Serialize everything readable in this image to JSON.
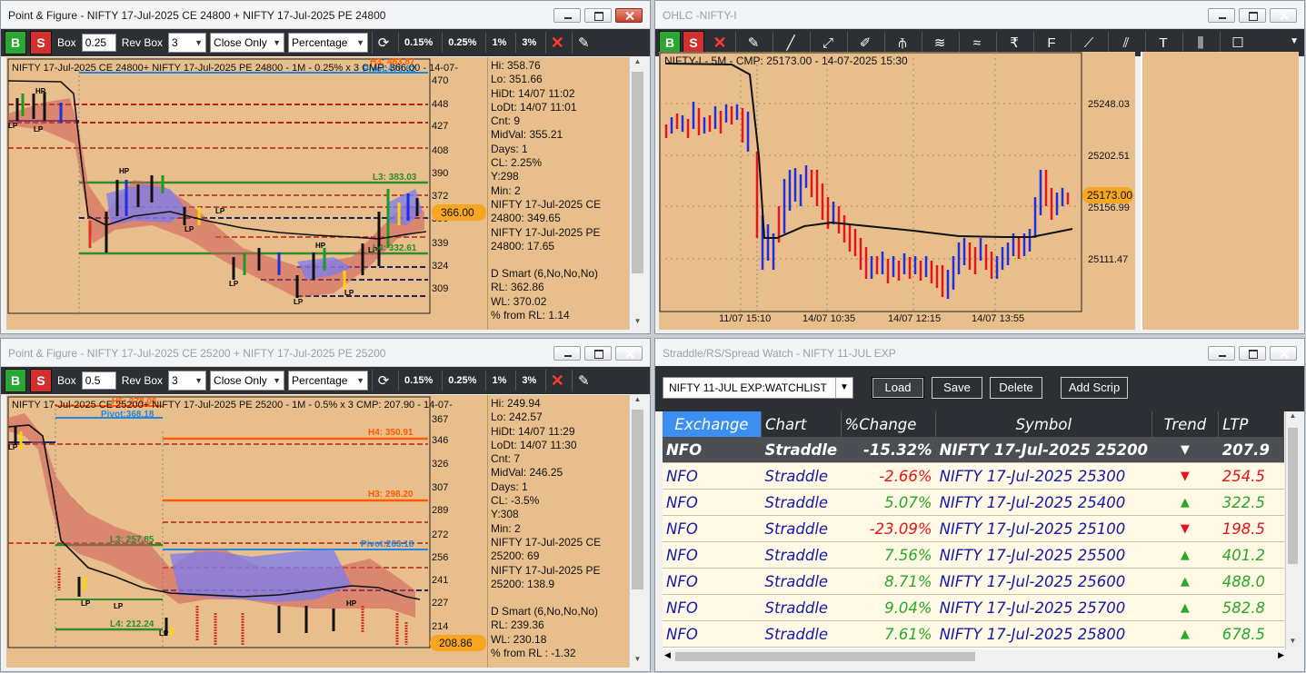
{
  "pnf_top": {
    "title": "Point & Figure - NIFTY 17-Jul-2025 CE 24800 + NIFTY 17-Jul-2025 PE 24800",
    "toolbar": {
      "b": "B",
      "s": "S",
      "box_label": "Box",
      "box_value": "0.25",
      "rev_label": "Rev Box",
      "rev_value": "3",
      "mode": "Close Only",
      "type": "Percentage",
      "p1": "0.15%",
      "p2": "0.25%",
      "p3": "1%",
      "p4": "3%"
    },
    "header": "NIFTY 17-Jul-2025 CE 24800+ NIFTY 17-Jul-2025 PE 24800 - 1M - 0.25% x 3 CMP: 366.00 - 14-07-",
    "price_ticks": [
      "470",
      "448",
      "427",
      "408",
      "390",
      "372",
      "356",
      "339",
      "324",
      "309"
    ],
    "cmp_badge": "366.00",
    "levels": {
      "h3": "H3: 483.87",
      "pivot": "Pivot:470.82",
      "l3": "L3: 383.03",
      "l4": "L4: 332.61"
    },
    "info": [
      "Hi: 358.76",
      "Lo: 351.66",
      "HiDt: 14/07 11:02",
      "LoDt: 14/07 11:01",
      "Cnt: 9",
      "MidVal: 355.21",
      "Days: 1",
      "CL: 2.25%",
      "Y:298",
      "Min: 2",
      "NIFTY 17-Jul-2025 CE",
      "24800: 349.65",
      "NIFTY 17-Jul-2025 PE",
      "24800: 17.65",
      "",
      "D Smart (6,No,No,No)",
      "RL: 362.86",
      "WL: 370.02",
      "% from RL: 1.14"
    ]
  },
  "ohlc": {
    "title": "OHLC -NIFTY-I",
    "toolbar": {
      "b": "B",
      "s": "S"
    },
    "header": "NIFTY-I - 5M - CMP: 25173.00 - 14-07-2025 15:30",
    "price_ticks": [
      "25248.03",
      "25202.51",
      "25156.99",
      "25111.47"
    ],
    "cmp_badge": "25173.00",
    "time_ticks": [
      "11/07 15:10",
      "14/07 10:35",
      "14/07 12:15",
      "14/07 13:55"
    ]
  },
  "pnf_bottom": {
    "title": "Point & Figure - NIFTY 17-Jul-2025 CE 25200 + NIFTY 17-Jul-2025 PE 25200",
    "toolbar": {
      "b": "B",
      "s": "S",
      "box_label": "Box",
      "box_value": "0.5",
      "rev_label": "Rev Box",
      "rev_value": "3",
      "mode": "Close Only",
      "type": "Percentage",
      "p1": "0.15%",
      "p2": "0.25%",
      "p3": "1%",
      "p4": "3%"
    },
    "header": "NIFTY 17-Jul-2025 CE 25200+ NIFTY 17-Jul-2025 PE 25200 - 1M - 0.5% x 3 CMP: 207.90 - 14-07-",
    "price_ticks": [
      "367",
      "346",
      "326",
      "307",
      "289",
      "272",
      "256",
      "241",
      "227",
      "214"
    ],
    "cmp_badge": "208.86",
    "levels": {
      "h3top": "H5: 378.06",
      "pivot": "Pivot:368.18",
      "h4": "H4: 350.91",
      "h3": "H3: 298.20",
      "l3": "L3: 257.85",
      "pivot2": "Pivot:263.18",
      "l4": "L4: 212.24"
    },
    "info": [
      "Hi: 249.94",
      "Lo: 242.57",
      "HiDt: 14/07 11:29",
      "LoDt: 14/07 11:30",
      "Cnt: 7",
      "MidVal: 246.25",
      "Days: 1",
      "CL: -3.5%",
      "Y:308",
      "Min: 2",
      "NIFTY 17-Jul-2025 CE",
      "25200: 69",
      "NIFTY 17-Jul-2025 PE",
      "25200: 138.9",
      "",
      "D Smart (6,No,No,No)",
      "RL: 239.36",
      "WL: 230.18",
      "% from RL : -1.32"
    ]
  },
  "watch": {
    "title": "Straddle/RS/Spread Watch - NIFTY 11-JUL EXP",
    "watchlist": "NIFTY 11-JUL EXP:WATCHLIST",
    "buttons": {
      "load": "Load",
      "save": "Save",
      "delete": "Delete",
      "add": "Add Scrip"
    },
    "columns": [
      "Exchange",
      "Chart",
      "%Change",
      "Symbol",
      "Trend",
      "LTP"
    ],
    "rows": [
      {
        "exchange": "NFO",
        "chart": "Straddle",
        "change": "-15.32%",
        "symbol": "NIFTY 17-Jul-2025 25200",
        "trend": "▼",
        "ltp": "207.9",
        "dir": "dn"
      },
      {
        "exchange": "NFO",
        "chart": "Straddle",
        "change": "-2.66%",
        "symbol": "NIFTY 17-Jul-2025 25300",
        "trend": "▼",
        "ltp": "254.5",
        "dir": "dn"
      },
      {
        "exchange": "NFO",
        "chart": "Straddle",
        "change": "5.07%",
        "symbol": "NIFTY 17-Jul-2025 25400",
        "trend": "▲",
        "ltp": "322.5",
        "dir": "up"
      },
      {
        "exchange": "NFO",
        "chart": "Straddle",
        "change": "-23.09%",
        "symbol": "NIFTY 17-Jul-2025 25100",
        "trend": "▼",
        "ltp": "198.5",
        "dir": "dn"
      },
      {
        "exchange": "NFO",
        "chart": "Straddle",
        "change": "7.56%",
        "symbol": "NIFTY 17-Jul-2025 25500",
        "trend": "▲",
        "ltp": "401.2",
        "dir": "up"
      },
      {
        "exchange": "NFO",
        "chart": "Straddle",
        "change": "8.71%",
        "symbol": "NIFTY 17-Jul-2025 25600",
        "trend": "▲",
        "ltp": "488.0",
        "dir": "up"
      },
      {
        "exchange": "NFO",
        "chart": "Straddle",
        "change": "9.04%",
        "symbol": "NIFTY 17-Jul-2025 25700",
        "trend": "▲",
        "ltp": "582.8",
        "dir": "up"
      },
      {
        "exchange": "NFO",
        "chart": "Straddle",
        "change": "7.61%",
        "symbol": "NIFTY 17-Jul-2025 25800",
        "trend": "▲",
        "ltp": "678.5",
        "dir": "up"
      }
    ]
  },
  "colors": {
    "chart_bg": "#e8bf8c",
    "toolbar_bg": "#2c2f33",
    "buy": "#2aa732",
    "sell": "#d32f2f",
    "bull": "#1f2ee0",
    "bear": "#e0161a"
  }
}
